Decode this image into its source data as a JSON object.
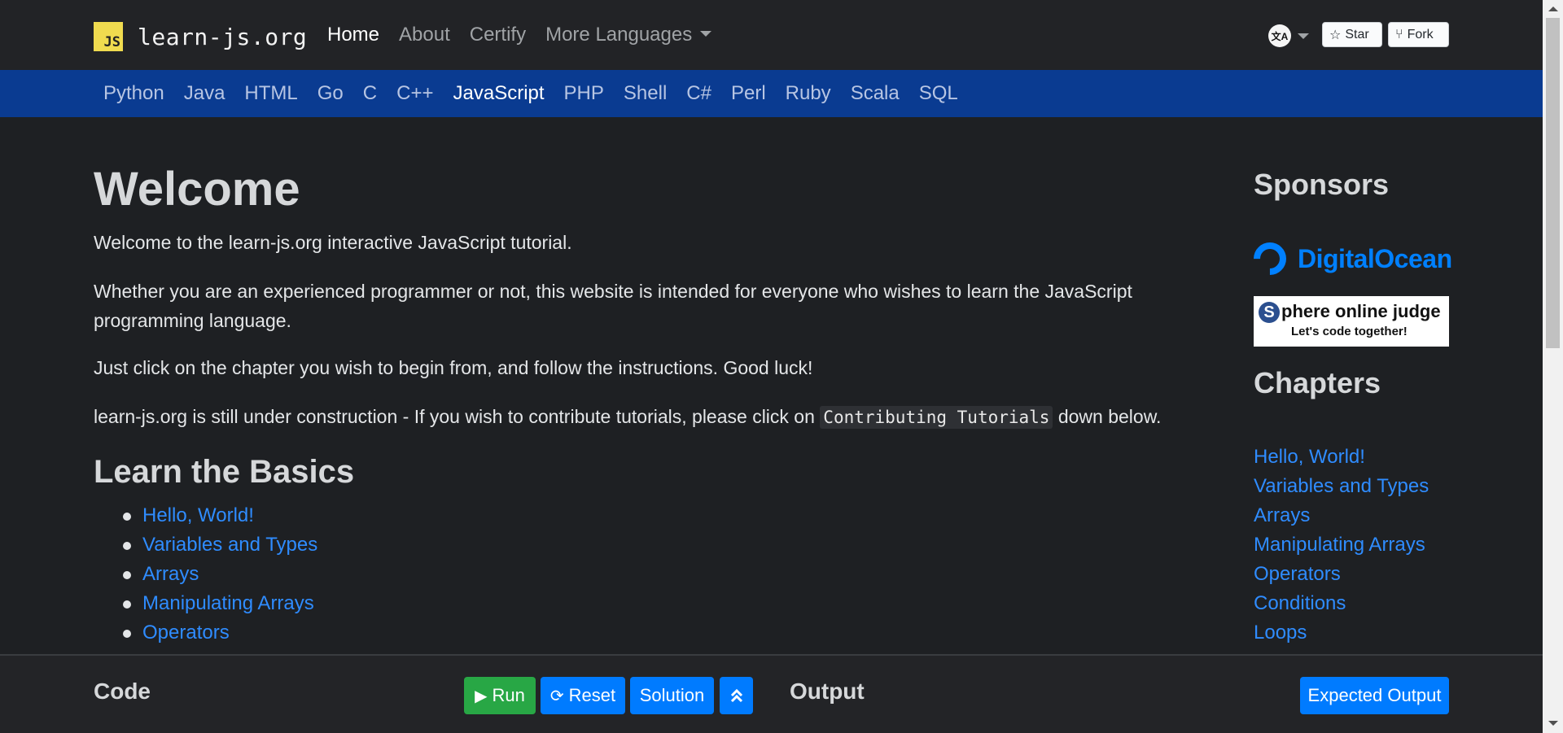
{
  "brand": {
    "logo_text": "JS",
    "name": "learn-js.org"
  },
  "top_nav": {
    "items": [
      {
        "label": "Home",
        "active": true
      },
      {
        "label": "About",
        "active": false
      },
      {
        "label": "Certify",
        "active": false
      },
      {
        "label": "More Languages",
        "active": false
      }
    ]
  },
  "language_switch": {
    "icon_text": "文A"
  },
  "github": {
    "star_label": "Star",
    "fork_label": "Fork"
  },
  "language_bar": {
    "items": [
      "Python",
      "Java",
      "HTML",
      "Go",
      "C",
      "C++",
      "JavaScript",
      "PHP",
      "Shell",
      "C#",
      "Perl",
      "Ruby",
      "Scala",
      "SQL"
    ],
    "active": "JavaScript"
  },
  "main": {
    "title": "Welcome",
    "p1": "Welcome to the learn-js.org interactive JavaScript tutorial.",
    "p2": "Whether you are an experienced programmer or not, this website is intended for everyone who wishes to learn the JavaScript programming language.",
    "p3": "Just click on the chapter you wish to begin from, and follow the instructions. Good luck!",
    "p4_before": "learn-js.org is still under construction - If you wish to contribute tutorials, please click on ",
    "p4_code": "Contributing Tutorials",
    "p4_after": " down below.",
    "section_title": "Learn the Basics",
    "basics": [
      "Hello, World!",
      "Variables and Types",
      "Arrays",
      "Manipulating Arrays",
      "Operators"
    ]
  },
  "sidebar": {
    "sponsors_title": "Sponsors",
    "digitalocean_text": "DigitalOcean",
    "spoj_letter": "S",
    "spoj_title": "phere online judge",
    "spoj_subtitle": "Let's code together!",
    "chapters_title": "Chapters",
    "chapters": [
      "Hello, World!",
      "Variables and Types",
      "Arrays",
      "Manipulating Arrays",
      "Operators",
      "Conditions",
      "Loops"
    ]
  },
  "bottom_bar": {
    "code_label": "Code",
    "run_label": "Run",
    "reset_label": "Reset",
    "solution_label": "Solution",
    "output_label": "Output",
    "expected_output_label": "Expected Output"
  },
  "colors": {
    "background": "#1e2023",
    "navbar": "#222326",
    "language_bar": "#0a3b91",
    "link": "#2f8cff",
    "run_button": "#28a745",
    "primary_button": "#007bff",
    "logo": "#f0db4f",
    "digitalocean": "#0080ff"
  },
  "icons": {
    "run": "play-icon",
    "reset": "refresh-icon",
    "expand": "double-chevron-up-icon",
    "star": "star-icon",
    "fork": "fork-icon",
    "language": "translate-icon"
  }
}
